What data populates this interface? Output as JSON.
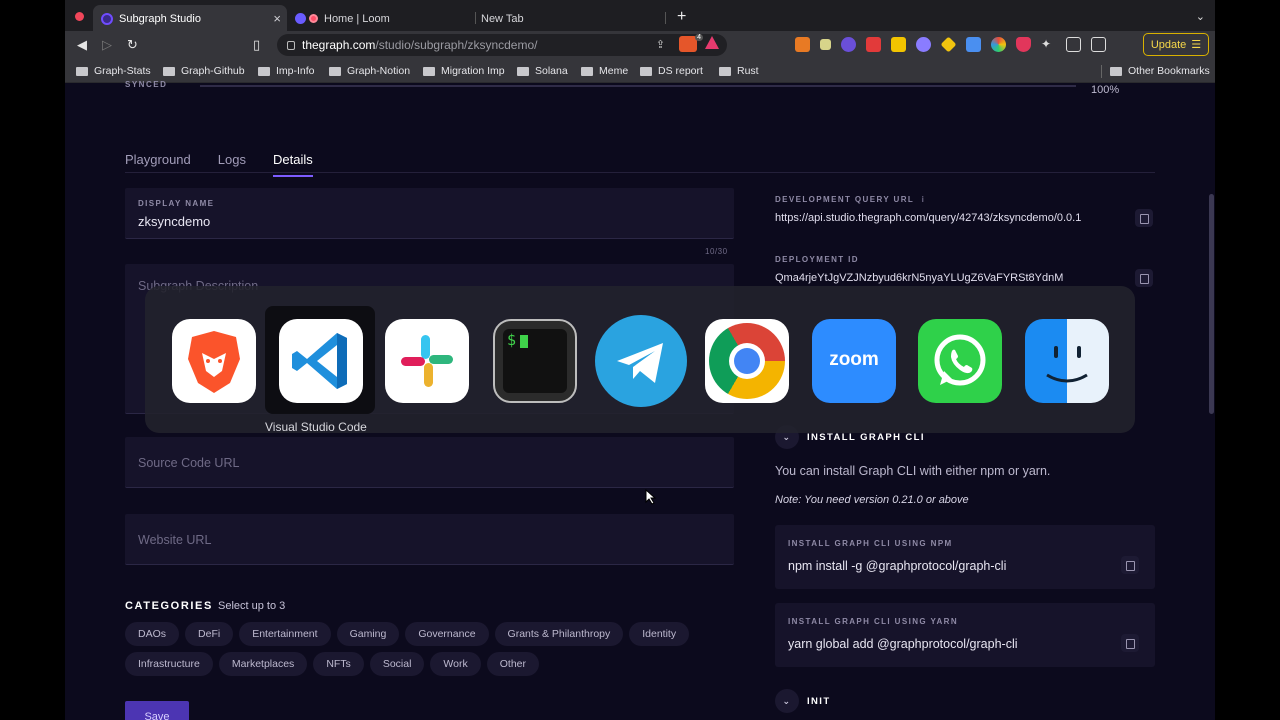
{
  "browser": {
    "tabs": [
      {
        "title": "Subgraph Studio",
        "close": "×"
      },
      {
        "title": "Home | Loom",
        "close": ""
      },
      {
        "title": "New Tab",
        "close": ""
      }
    ],
    "new_tab": "+",
    "tab_menu": "⌄",
    "url_host": "thegraph.com",
    "url_path": "/studio/subgraph/zksyncdemo/",
    "update_label": "Update",
    "bookmarks": [
      "Graph-Stats",
      "Graph-Github",
      "Imp-Info",
      "Graph-Notion",
      "Migration Imp",
      "Solana",
      "Meme",
      "DS report",
      "Rust"
    ],
    "other_bookmarks": "Other Bookmarks",
    "ext_badges": {
      "brave": "4",
      "ext1": "2",
      "ext2": "2"
    }
  },
  "page": {
    "synced": "SYNCED",
    "progress_pct": "100%",
    "tabs": [
      "Playground",
      "Logs",
      "Details"
    ],
    "active_tab": "Details",
    "display_name": {
      "label": "DISPLAY NAME",
      "value": "zksyncdemo",
      "counter": "10/30"
    },
    "description_placeholder": "Subgraph Description",
    "source_placeholder": "Source Code URL",
    "website_placeholder": "Website URL",
    "categories": {
      "title": "CATEGORIES",
      "subtitle": "Select up to 3",
      "row1": [
        "DAOs",
        "DeFi",
        "Entertainment",
        "Gaming",
        "Governance",
        "Grants & Philanthropy",
        "Identity"
      ],
      "row2": [
        "Infrastructure",
        "Marketplaces",
        "NFTs",
        "Social",
        "Work",
        "Other"
      ]
    },
    "save_label": "Save"
  },
  "right": {
    "query_url_label": "DEVELOPMENT QUERY URL",
    "query_url_info": "i",
    "query_url": "https://api.studio.thegraph.com/query/42743/zksyncdemo/0.0.1",
    "deploy_label": "DEPLOYMENT ID",
    "deploy_id": "Qma4rjeYtJgVZJNzbyud6krN5nyaYLUgZ6VaFYRSt8YdnM",
    "install_title": "INSTALL GRAPH CLI",
    "install_text": "You can install Graph CLI with either npm or yarn.",
    "install_note": "Note: You need version 0.21.0 or above",
    "npm_label": "INSTALL GRAPH CLI USING NPM",
    "npm_cmd": "npm install -g @graphprotocol/graph-cli",
    "yarn_label": "INSTALL GRAPH CLI USING YARN",
    "yarn_cmd": "yarn global add @graphprotocol/graph-cli",
    "init_title": "INIT"
  },
  "switcher": {
    "apps": [
      "brave-browser",
      "visual-studio-code",
      "slack",
      "terminal",
      "telegram",
      "google-chrome",
      "zoom",
      "whatsapp",
      "finder"
    ],
    "selected_label": "Visual Studio Code",
    "terminal_glyph": "$",
    "zoom_text": "zoom"
  },
  "colors": {
    "accent": "#7d5cff",
    "background": "#0c0a1d",
    "update": "#f6d84a"
  }
}
